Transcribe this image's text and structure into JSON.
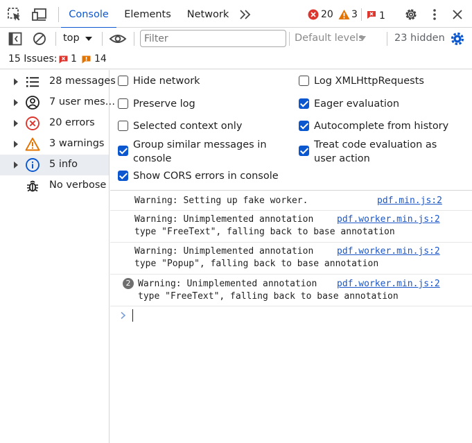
{
  "tabs": {
    "console": "Console",
    "elements": "Elements",
    "network": "Network"
  },
  "status": {
    "errors": "20",
    "warnings": "3",
    "issues": "1"
  },
  "toolbar": {
    "context": "top",
    "filter_placeholder": "Filter",
    "levels": "Default levels",
    "hidden": "23 hidden"
  },
  "issues_bar": {
    "label": "15 Issues:",
    "errors": "1",
    "warnings": "14"
  },
  "sidebar": {
    "items": [
      {
        "label": "28 messages",
        "icon": "list-icon"
      },
      {
        "label": "7 user mes…",
        "icon": "user-icon"
      },
      {
        "label": "20 errors",
        "icon": "error-icon"
      },
      {
        "label": "3 warnings",
        "icon": "warning-icon"
      },
      {
        "label": "5 info",
        "icon": "info-icon"
      },
      {
        "label": "No verbose",
        "icon": "bug-icon"
      }
    ]
  },
  "settings": {
    "left": [
      {
        "label": "Hide network",
        "checked": false
      },
      {
        "label": "Preserve log",
        "checked": false
      },
      {
        "label": "Selected context only",
        "checked": false
      },
      {
        "label": "Group similar messages in console",
        "checked": true
      },
      {
        "label": "Show CORS errors in console",
        "checked": true
      }
    ],
    "right": [
      {
        "label": "Log XMLHttpRequests",
        "checked": false
      },
      {
        "label": "Eager evaluation",
        "checked": true
      },
      {
        "label": "Autocomplete from history",
        "checked": true
      },
      {
        "label": "Treat code evaluation as user action",
        "checked": true
      }
    ]
  },
  "messages": [
    {
      "line1": "Warning: Setting up fake worker.",
      "line2": "",
      "source": "pdf.min.js:2",
      "repeat": ""
    },
    {
      "line1": "Warning: Unimplemented annotation",
      "line2": "type \"FreeText\", falling back to base annotation",
      "source": "pdf.worker.min.js:2",
      "repeat": ""
    },
    {
      "line1": "Warning: Unimplemented annotation",
      "line2": "type \"Popup\", falling back to base annotation",
      "source": "pdf.worker.min.js:2",
      "repeat": ""
    },
    {
      "line1": "Warning: Unimplemented annotation",
      "line2": "type \"FreeText\", falling back to base annotation",
      "source": "pdf.worker.min.js:2",
      "repeat": "2"
    }
  ],
  "colors": {
    "accent": "#0b57d0",
    "error": "#dc362e",
    "warning": "#e37400"
  }
}
